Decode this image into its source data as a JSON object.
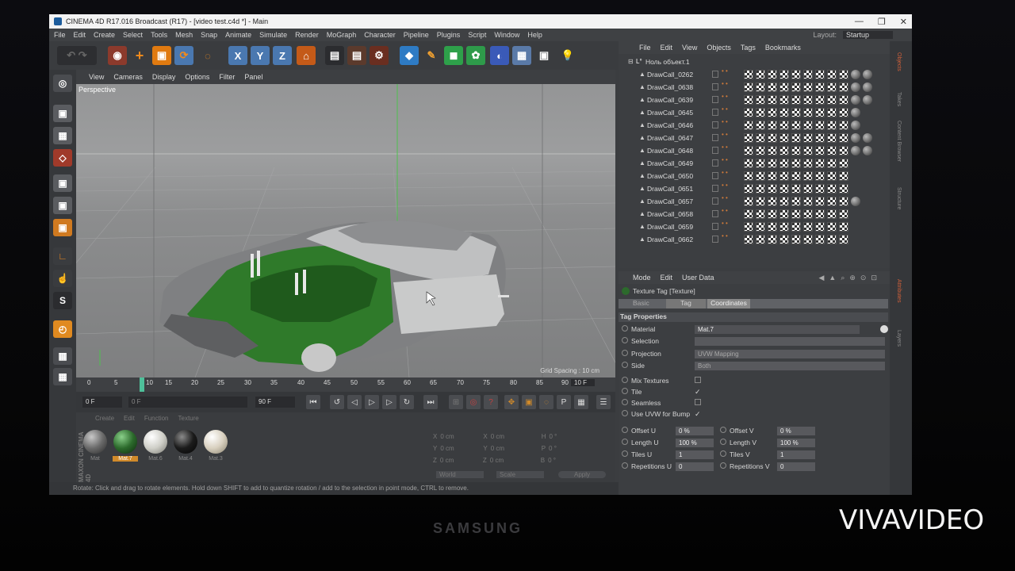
{
  "window": {
    "title": "CINEMA 4D R17.016 Broadcast (R17) - [video test.c4d *] - Main"
  },
  "menubar": {
    "items": [
      "File",
      "Edit",
      "Create",
      "Select",
      "Tools",
      "Mesh",
      "Snap",
      "Animate",
      "Simulate",
      "Render",
      "MoGraph",
      "Character",
      "Pipeline",
      "Plugins",
      "Script",
      "Window",
      "Help"
    ],
    "layout_label": "Layout:",
    "layout_value": "Startup"
  },
  "viewport_menu": {
    "items": [
      "View",
      "Cameras",
      "Display",
      "Options",
      "Filter",
      "Panel"
    ]
  },
  "viewport": {
    "label": "Perspective",
    "grid_spacing": "Grid Spacing : 10 cm"
  },
  "timeline": {
    "ticks": [
      "0",
      "5",
      "10",
      "15",
      "20",
      "25",
      "30",
      "35",
      "40",
      "45",
      "50",
      "55",
      "60",
      "65",
      "70",
      "75",
      "80",
      "85",
      "90"
    ],
    "current_frame": "10 F"
  },
  "playbar": {
    "start_field": "0 F",
    "min_field": "0 F",
    "max_field": "90 F",
    "end_field": "90 F"
  },
  "materials": {
    "menu": [
      "Create",
      "Edit",
      "Function",
      "Texture"
    ],
    "items": [
      {
        "label": "Mat",
        "color": "#6a6a6a"
      },
      {
        "label": "Mat.7",
        "color": "#2c6a2c"
      },
      {
        "label": "Mat.6",
        "color": "#cfcfc8"
      },
      {
        "label": "Mat.4",
        "color": "#1b1b1b"
      },
      {
        "label": "Mat.3",
        "color": "#d8d0bf"
      }
    ],
    "brand": "MAXON CINEMA 4D"
  },
  "coords": {
    "rows": [
      {
        "a": "X",
        "av": "0 cm",
        "b": "X",
        "bv": "0 cm",
        "c": "H",
        "cv": "0 °"
      },
      {
        "a": "Y",
        "av": "0 cm",
        "b": "Y",
        "bv": "0 cm",
        "c": "P",
        "cv": "0 °"
      },
      {
        "a": "Z",
        "av": "0 cm",
        "b": "Z",
        "bv": "0 cm",
        "c": "B",
        "cv": "0 °"
      }
    ],
    "mode": "World",
    "scale": "Scale",
    "apply": "Apply"
  },
  "statusbar": {
    "text": "Rotate: Click and drag to rotate elements. Hold down SHIFT to add to quantize rotation / add to the selection in point mode, CTRL to remove."
  },
  "objects": {
    "menu": [
      "File",
      "Edit",
      "View",
      "Objects",
      "Tags",
      "Bookmarks"
    ],
    "root": "Ноль объект.1",
    "items": [
      "DrawCall_0262",
      "DrawCall_0638",
      "DrawCall_0639",
      "DrawCall_0645",
      "DrawCall_0646",
      "DrawCall_0647",
      "DrawCall_0648",
      "DrawCall_0649",
      "DrawCall_0650",
      "DrawCall_0651",
      "DrawCall_0657",
      "DrawCall_0658",
      "DrawCall_0659",
      "DrawCall_0662"
    ]
  },
  "attributes": {
    "menu": [
      "Mode",
      "Edit",
      "User Data"
    ],
    "title": "Texture Tag [Texture]",
    "tabs": [
      "Basic",
      "Tag",
      "Coordinates"
    ],
    "section": "Tag Properties",
    "material_label": "Material",
    "material_value": "Mat.7",
    "selection_label": "Selection",
    "projection_label": "Projection",
    "projection_value": "UVW Mapping",
    "side_label": "Side",
    "side_value": "Both",
    "mix_textures": "Mix Textures",
    "tile": "Tile",
    "seamless": "Seamless",
    "use_uvw": "Use UVW for Bump",
    "offset_u_label": "Offset U",
    "offset_u": "0 %",
    "offset_v_label": "Offset V",
    "offset_v": "0 %",
    "length_u_label": "Length U",
    "length_u": "100 %",
    "length_v_label": "Length V",
    "length_v": "100 %",
    "tiles_u_label": "Tiles U",
    "tiles_u": "1",
    "tiles_v_label": "Tiles V",
    "tiles_v": "1",
    "rep_u_label": "Repetitions U",
    "rep_u": "0",
    "rep_v_label": "Repetitions V",
    "rep_v": "0"
  },
  "side_tabs": [
    "Objects",
    "Takes",
    "Content Browser",
    "Structure",
    "Attributes",
    "Layers"
  ],
  "monitor_brand": "SAMSUNG",
  "watermark": "VIVAVIDEO"
}
